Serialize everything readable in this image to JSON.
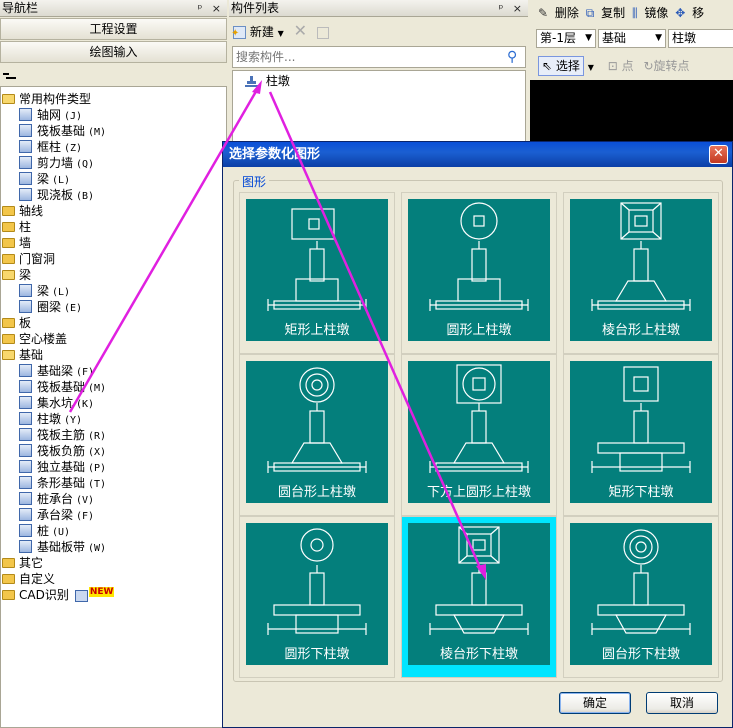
{
  "nav": {
    "title": "导航栏",
    "pin": "ᵖ ×",
    "btn_project": "工程设置",
    "btn_draw": "绘图输入",
    "tree": [
      {
        "label": "常用构件类型",
        "kind": "folder-open"
      },
      {
        "label": "轴网",
        "hk": "(J)",
        "kind": "axis-grid-icon"
      },
      {
        "label": "筏板基础",
        "hk": "(M)",
        "kind": "raft-icon"
      },
      {
        "label": "框柱",
        "hk": "(Z)",
        "kind": "column-icon"
      },
      {
        "label": "剪力墙",
        "hk": "(Q)",
        "kind": "wall-icon"
      },
      {
        "label": "梁",
        "hk": "(L)",
        "kind": "beam-icon"
      },
      {
        "label": "现浇板",
        "hk": "(B)",
        "kind": "slab-icon"
      },
      {
        "label": "轴线",
        "kind": "folder"
      },
      {
        "label": "柱",
        "kind": "folder"
      },
      {
        "label": "墙",
        "kind": "folder"
      },
      {
        "label": "门窗洞",
        "kind": "folder"
      },
      {
        "label": "梁",
        "kind": "folder-open"
      },
      {
        "label": "梁",
        "hk": "(L)",
        "kind": "beam-icon"
      },
      {
        "label": "圈梁",
        "hk": "(E)",
        "kind": "ring-beam-icon"
      },
      {
        "label": "板",
        "kind": "folder"
      },
      {
        "label": "空心楼盖",
        "kind": "folder"
      },
      {
        "label": "基础",
        "kind": "folder-open"
      },
      {
        "label": "基础梁",
        "hk": "(F)",
        "kind": "foundation-beam-icon"
      },
      {
        "label": "筏板基础",
        "hk": "(M)",
        "kind": "raft-icon"
      },
      {
        "label": "集水坑",
        "hk": "(K)",
        "kind": "sump-icon"
      },
      {
        "label": "柱墩",
        "hk": "(Y)",
        "kind": "pier-icon"
      },
      {
        "label": "筏板主筋",
        "hk": "(R)",
        "kind": "raft-rebar-icon"
      },
      {
        "label": "筏板负筋",
        "hk": "(X)",
        "kind": "raft-rebar-icon"
      },
      {
        "label": "独立基础",
        "hk": "(P)",
        "kind": "isolated-footing-icon"
      },
      {
        "label": "条形基础",
        "hk": "(T)",
        "kind": "strip-footing-icon"
      },
      {
        "label": "桩承台",
        "hk": "(V)",
        "kind": "pile-cap-icon"
      },
      {
        "label": "承台梁",
        "hk": "(F)",
        "kind": "cap-beam-icon"
      },
      {
        "label": "桩",
        "hk": "(U)",
        "kind": "pile-icon"
      },
      {
        "label": "基础板带",
        "hk": "(W)",
        "kind": "strip-icon"
      },
      {
        "label": "其它",
        "kind": "folder"
      },
      {
        "label": "自定义",
        "kind": "folder"
      },
      {
        "label": "CAD识别",
        "kind": "folder",
        "badge": "NEW"
      }
    ]
  },
  "comp": {
    "title": "构件列表",
    "pin": "ᵖ ×",
    "new": "新建",
    "search_placeholder": "搜索构件...",
    "item": "柱墩"
  },
  "toolbar": {
    "delete": "删除",
    "copy": "复制",
    "mirror": "镜像",
    "move": "移",
    "floor": "第-1层",
    "category": "基础",
    "type": "柱墩",
    "select": "选择",
    "point": "点",
    "rotate_point": "旋转点"
  },
  "dialog": {
    "title": "选择参数化图形",
    "group": "图形",
    "ok": "确定",
    "cancel": "取消",
    "shapes": [
      {
        "label": "矩形上柱墩",
        "top": "rect",
        "base": "rect-up"
      },
      {
        "label": "圆形上柱墩",
        "top": "circle",
        "base": "rect-up"
      },
      {
        "label": "棱台形上柱墩",
        "top": "frustum-square",
        "base": "trap-up"
      },
      {
        "label": "圆台形上柱墩",
        "top": "concentric",
        "base": "trap-up"
      },
      {
        "label": "下方上圆形上柱墩",
        "top": "square-circle",
        "base": "trap-up"
      },
      {
        "label": "矩形下柱墩",
        "top": "rect-plain",
        "base": "rect-down"
      },
      {
        "label": "圆形下柱墩",
        "top": "circle-small",
        "base": "rect-down"
      },
      {
        "label": "棱台形下柱墩",
        "top": "frustum-square",
        "base": "trap-down",
        "selected": true
      },
      {
        "label": "圆台形下柱墩",
        "top": "concentric",
        "base": "trap-down"
      }
    ]
  }
}
